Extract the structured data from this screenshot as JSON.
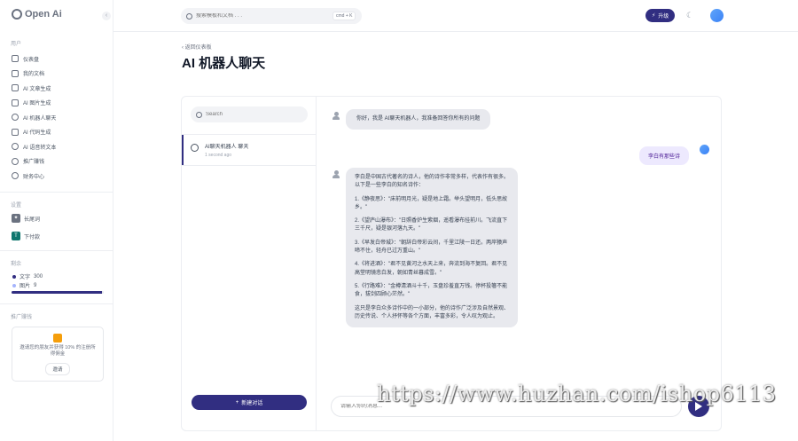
{
  "brand": {
    "name": "Open Ai"
  },
  "sidebar": {
    "section_user": "用户",
    "items": [
      {
        "label": "仪表盘",
        "icon": "dashboard-icon"
      },
      {
        "label": "我的文档",
        "icon": "document-icon"
      },
      {
        "label": "AI 文章生成",
        "icon": "article-icon"
      },
      {
        "label": "AI 图片生成",
        "icon": "image-icon"
      },
      {
        "label": "AI 机器人聊天",
        "icon": "chat-icon"
      },
      {
        "label": "AI 代码生成",
        "icon": "code-icon"
      },
      {
        "label": "AI 语音转文本",
        "icon": "microphone-icon"
      },
      {
        "label": "推广赚钱",
        "icon": "dollar-icon"
      },
      {
        "label": "财务中心",
        "icon": "wallet-icon"
      }
    ],
    "section_apps": "设置",
    "apps": [
      {
        "badge": "✦",
        "label": "长尾词"
      },
      {
        "badge": "T",
        "label": "下付款"
      }
    ],
    "section_stats": "剩余",
    "stats": [
      {
        "label": "文字",
        "value": "300"
      },
      {
        "label": "图片",
        "value": "9"
      }
    ],
    "usage_fraction": 0.98,
    "section_promo": "推广赚钱",
    "promo": {
      "text": "邀请您的朋友并获得 10% 的注册所得佣金",
      "button": "邀请"
    }
  },
  "header": {
    "search_placeholder": "搜索模板和文档 . . .",
    "shortcut": "cmd + K",
    "upgrade_label": "升级"
  },
  "page": {
    "back_label": "返回仪表板",
    "title": "AI 机器人聊天"
  },
  "conversations": {
    "search_placeholder": "Search",
    "items": [
      {
        "title": "AI聊天机器人 聊天",
        "time": "1 second ago"
      }
    ],
    "new_chat_label": "新建对话"
  },
  "messages": [
    {
      "role": "bot",
      "text": "你好，我是 AI聊天机器人，我准备回答你所有的问题"
    },
    {
      "role": "user",
      "text": "李白有那些诗"
    },
    {
      "role": "bot",
      "paragraphs": [
        "李白是中国古代著名的诗人，他的诗作非常多样，代表作有很多。以下是一些李白的知名诗作：",
        "1.《静夜思》：\"床前明月光，疑是地上霜。举头望明月，低头思故乡。\"",
        "2.《望庐山瀑布》：\"日照香炉生紫烟，遥看瀑布挂前川。飞流直下三千尺，疑是银河落九天。\"",
        "3.《早发白帝城》：\"朝辞白帝彩云间，千里江陵一日还。两岸猿声啼不住，轻舟已过万重山。\"",
        "4.《将进酒》：\"君不见黄河之水天上来，奔流到海不复回。君不见高堂明镜悲白发，朝如青丝暮成雪。\"",
        "5.《行路难》：\"金樽清酒斗十千，玉盘珍羞直万钱。停杯投箸不能食，拔剑四顾心茫然。\"",
        "这只是李白众多诗作中的一小部分，他的诗作广泛涉及自然景观、历史传说、个人抒怀等各个方面，丰富多彩，令人叹为观止。"
      ]
    }
  ],
  "composer": {
    "placeholder": "请输入你的消息..."
  },
  "watermark": "https://www.huzhan.com/ishop6113",
  "colors": {
    "accent": "#312e81",
    "user_bubble": "#ede9fe",
    "bot_bubble": "#e8e9ee"
  }
}
